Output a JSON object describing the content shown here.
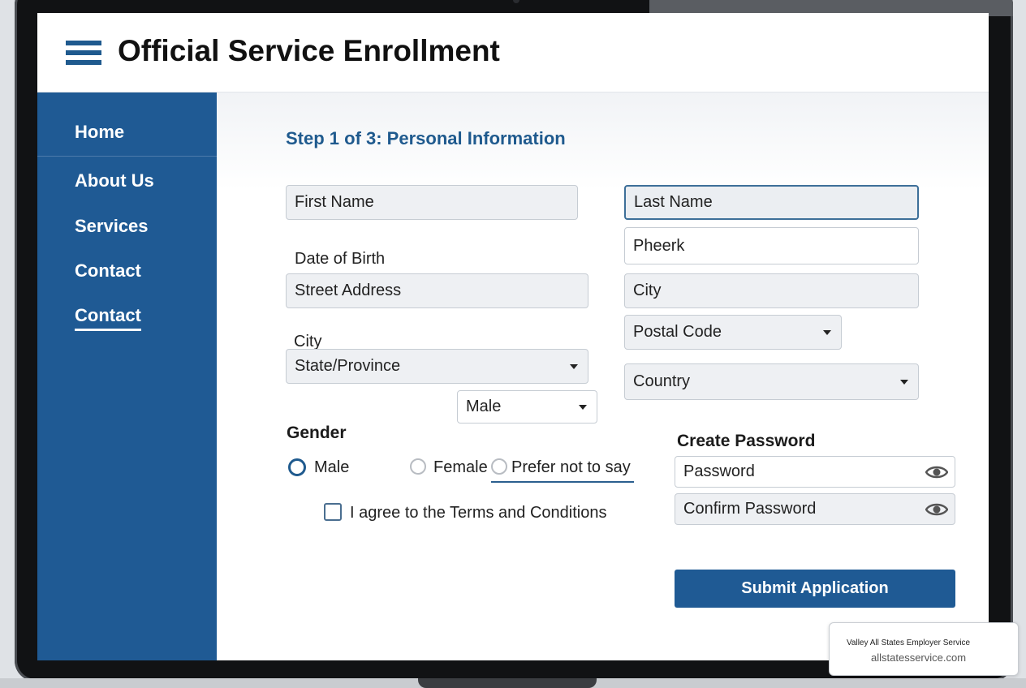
{
  "header": {
    "title": "Official Service Enrollment",
    "menu_icon": "hamburger-menu-icon"
  },
  "sidebar": {
    "items": [
      {
        "label": "Home"
      },
      {
        "label": "About Us"
      },
      {
        "label": "Services"
      },
      {
        "label": "Contact"
      },
      {
        "label": "Contact",
        "active": true
      }
    ]
  },
  "form": {
    "step_title": "Step 1 of 3: Personal Information",
    "first_name": {
      "placeholder": "First Name"
    },
    "last_name": {
      "placeholder": "Last Name"
    },
    "date_of_birth_label": "Date of Birth",
    "dob_value": "Pheerk",
    "street_address": {
      "placeholder": "Street Address"
    },
    "city_input": {
      "placeholder": "City"
    },
    "city_label": "City",
    "postal_code": {
      "selected": "Postal Code"
    },
    "state_province": {
      "selected": "State/Province"
    },
    "country": {
      "selected": "Country"
    },
    "gender": {
      "label": "Gender",
      "select_value": "Male",
      "options": [
        {
          "label": "Male",
          "checked": true
        },
        {
          "label": "Female",
          "checked": false
        },
        {
          "label": "Prefer not to say",
          "checked": false
        }
      ]
    },
    "terms_label": "I agree to the Terms and Conditions",
    "terms_checked": false,
    "password_section": {
      "heading": "Create Password",
      "password_placeholder": "Password",
      "confirm_placeholder": "Confirm Password",
      "toggle_icon": "eye-icon"
    },
    "submit_label": "Submit Application"
  },
  "footer_badge": {
    "title": "Valley All States Employer Service",
    "url": "allstatesservice.com"
  },
  "colors": {
    "brand": "#1f5a94",
    "accent_text": "#1f5a8e",
    "field_bg": "#eef0f3"
  }
}
